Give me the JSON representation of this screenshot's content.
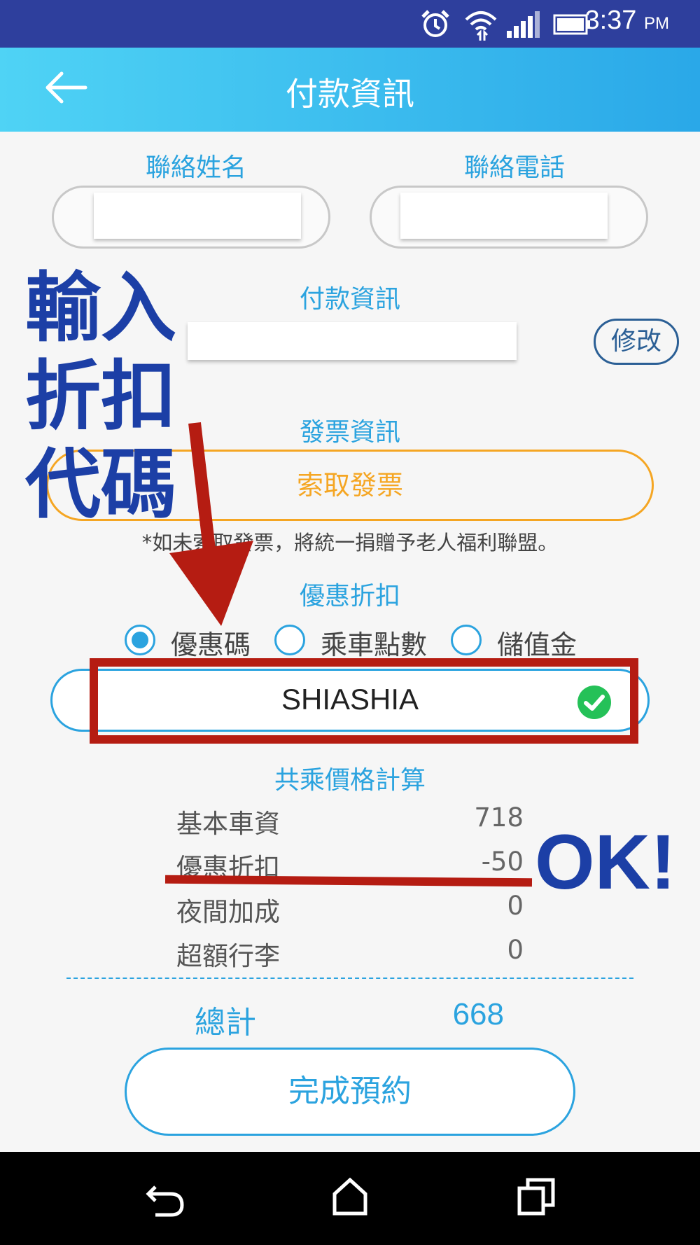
{
  "status_bar": {
    "time": "3:37",
    "ampm": "PM"
  },
  "app_bar": {
    "title": "付款資訊"
  },
  "contact": {
    "name_label": "聯絡姓名",
    "phone_label": "聯絡電話"
  },
  "payment": {
    "label": "付款資訊",
    "edit_label": "修改"
  },
  "invoice": {
    "label": "發票資訊",
    "button_label": "索取發票",
    "note": "*如未索取發票，將統一捐贈予老人福利聯盟。"
  },
  "discount": {
    "label": "優惠折扣",
    "options": [
      "優惠碼",
      "乘車點數",
      "儲值金"
    ],
    "selected": "優惠碼",
    "code_value": "SHIASHIA"
  },
  "price": {
    "title": "共乘價格計算",
    "rows": [
      {
        "label": "基本車資",
        "value": "718"
      },
      {
        "label": "優惠折扣",
        "value": "-50"
      },
      {
        "label": "夜間加成",
        "value": "0"
      },
      {
        "label": "超額行李",
        "value": "0"
      }
    ],
    "total_label": "總計",
    "total_value": "668"
  },
  "submit": {
    "label": "完成預約"
  },
  "annotation": {
    "line1": "輸入",
    "line2": "折扣",
    "line3": "代碼",
    "ok": "OK!"
  },
  "colors": {
    "accent": "#2ba3df",
    "invoice": "#f5a623",
    "annotation_red": "#b51c12",
    "annotation_blue": "#1c3fa6"
  }
}
